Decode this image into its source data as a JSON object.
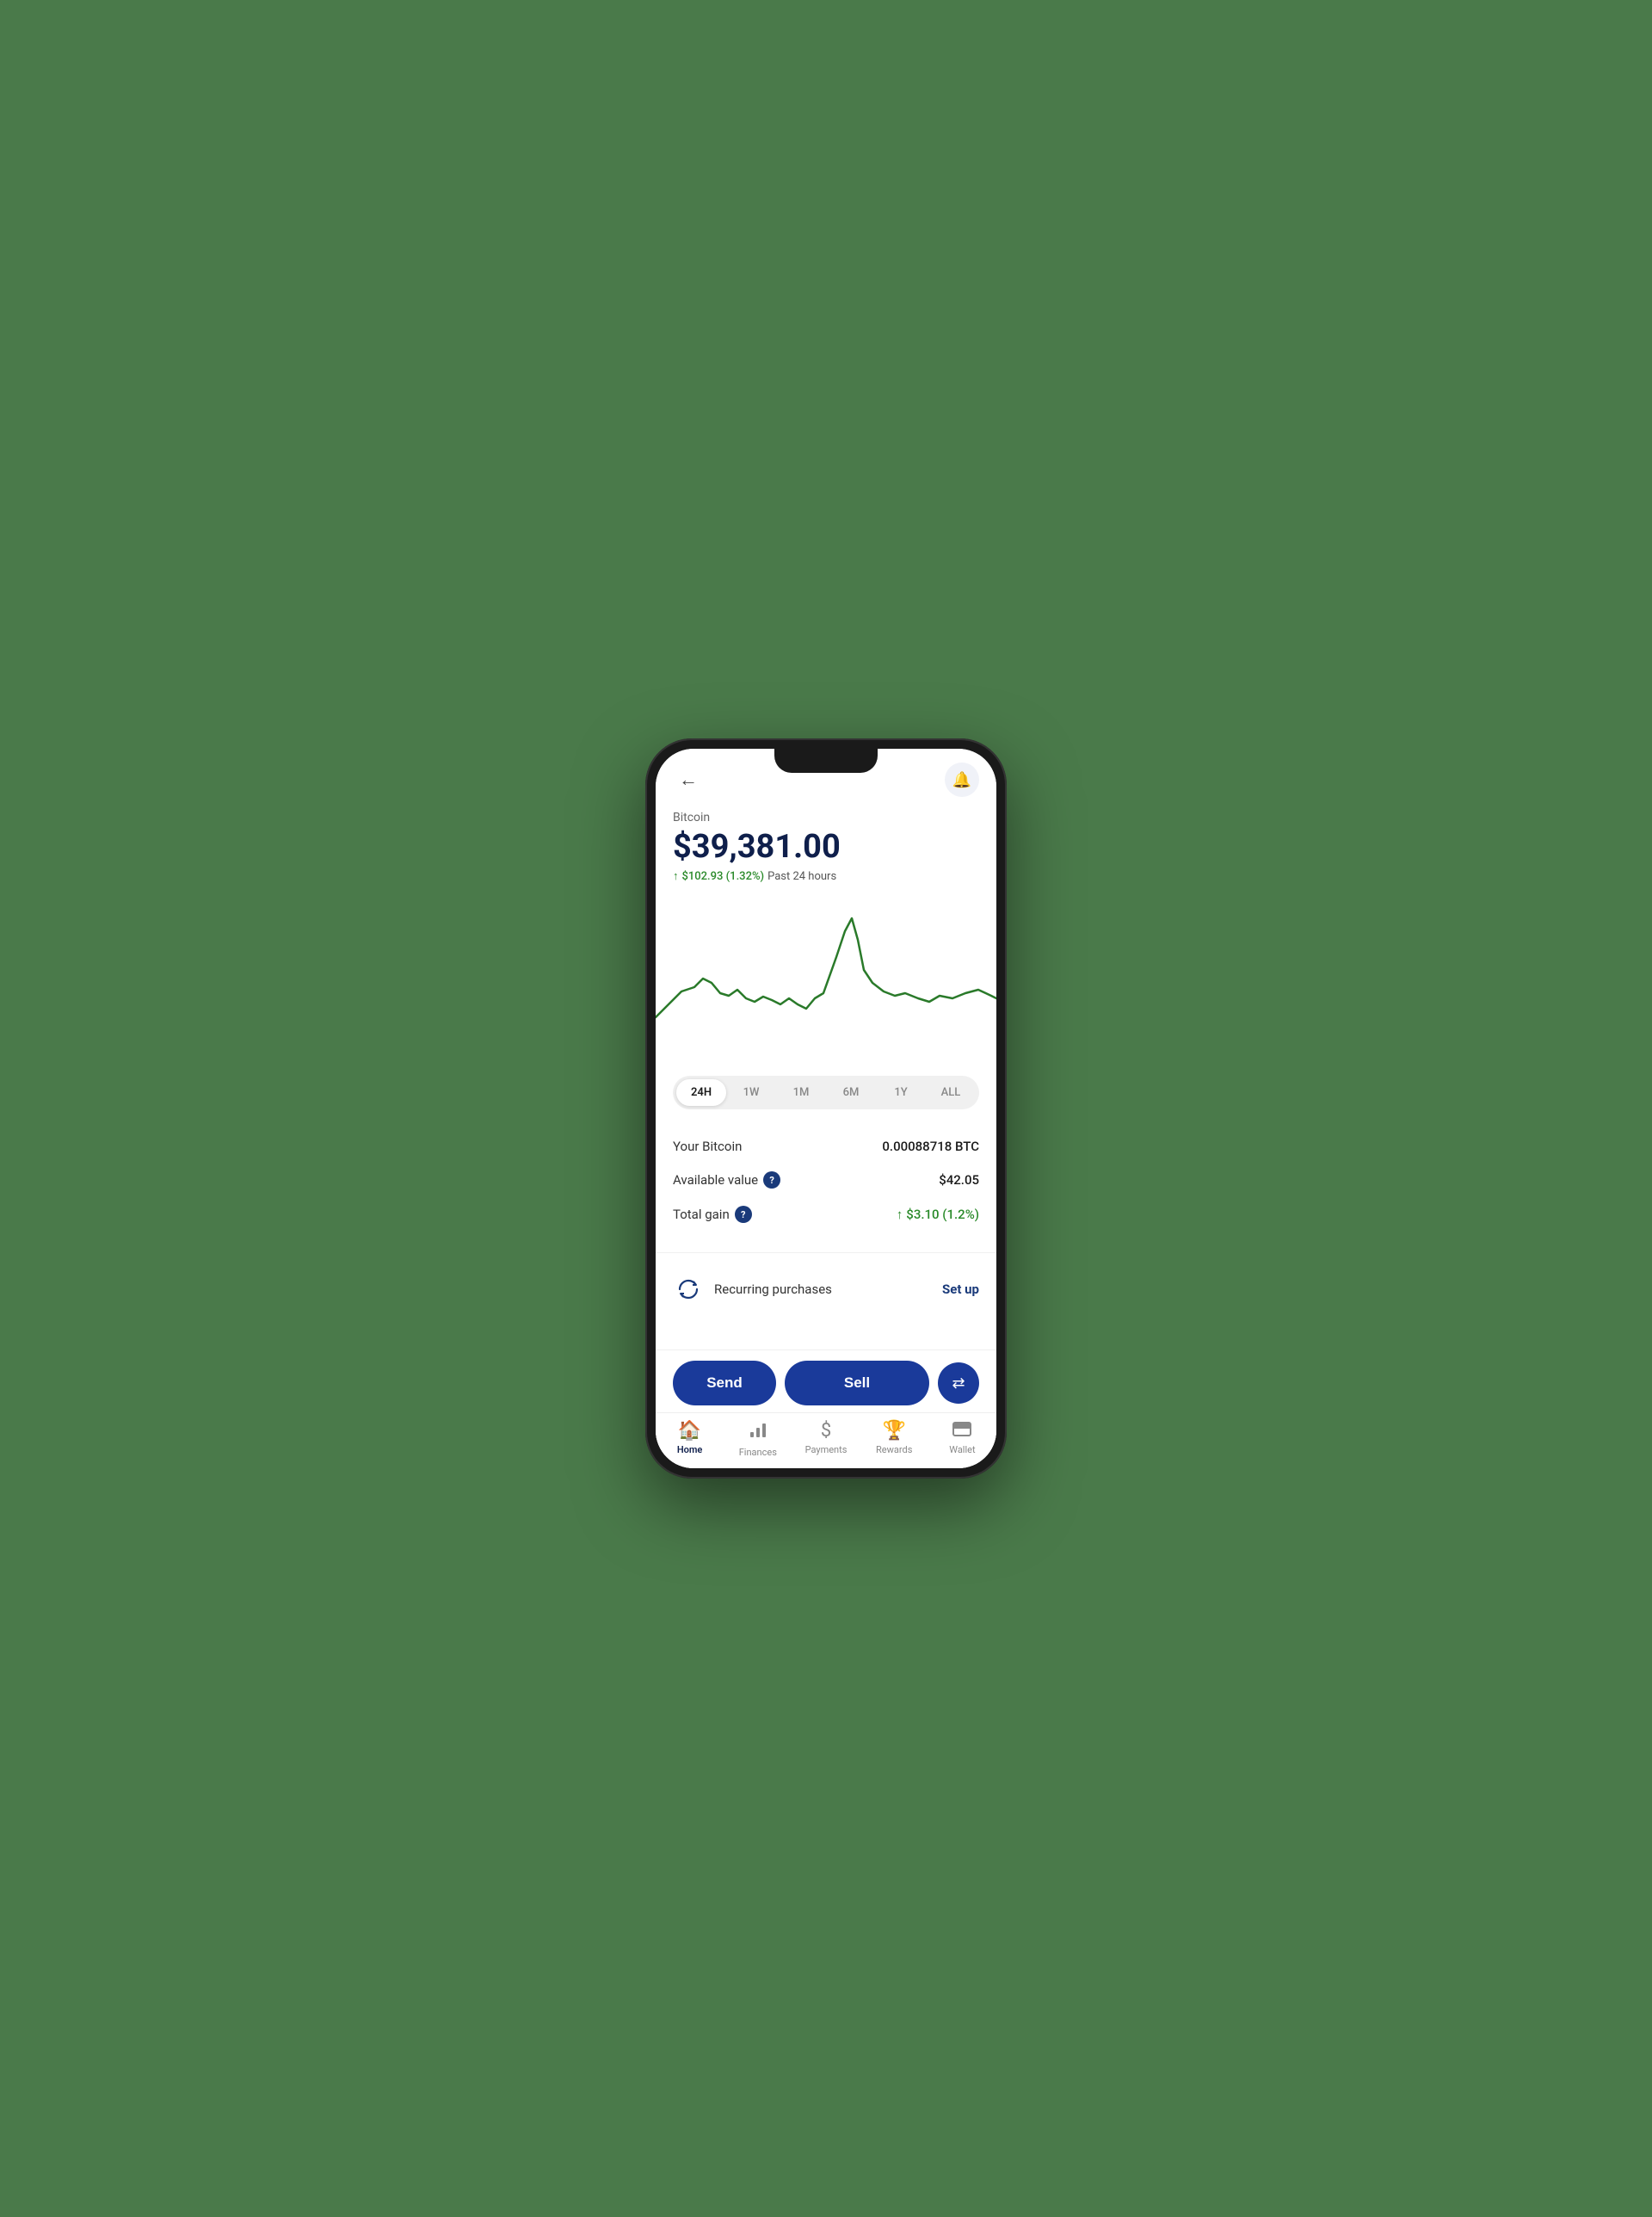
{
  "header": {
    "back_label": "←",
    "bell_label": "🔔"
  },
  "crypto": {
    "name": "Bitcoin",
    "price": "$39,381.00",
    "change_amount": "$102.93 (1.32%)",
    "change_period": "Past 24 hours",
    "up_arrow": "↑"
  },
  "time_filters": [
    {
      "label": "24H",
      "active": true
    },
    {
      "label": "1W",
      "active": false
    },
    {
      "label": "1M",
      "active": false
    },
    {
      "label": "6M",
      "active": false
    },
    {
      "label": "1Y",
      "active": false
    },
    {
      "label": "ALL",
      "active": false
    }
  ],
  "stats": {
    "your_bitcoin_label": "Your Bitcoin",
    "your_bitcoin_value": "0.00088718 BTC",
    "available_value_label": "Available value",
    "available_value": "$42.05",
    "total_gain_label": "Total gain",
    "total_gain_value": "$3.10 (1.2%)"
  },
  "recurring": {
    "label": "Recurring purchases",
    "action": "Set up"
  },
  "actions": {
    "send": "Send",
    "sell": "Sell",
    "swap": "⇄"
  },
  "nav": [
    {
      "label": "Home",
      "active": true,
      "icon": "🏠"
    },
    {
      "label": "Finances",
      "active": false,
      "icon": "📊"
    },
    {
      "label": "Payments",
      "active": false,
      "icon": "$"
    },
    {
      "label": "Rewards",
      "active": false,
      "icon": "🏆"
    },
    {
      "label": "Wallet",
      "active": false,
      "icon": "▤"
    }
  ]
}
